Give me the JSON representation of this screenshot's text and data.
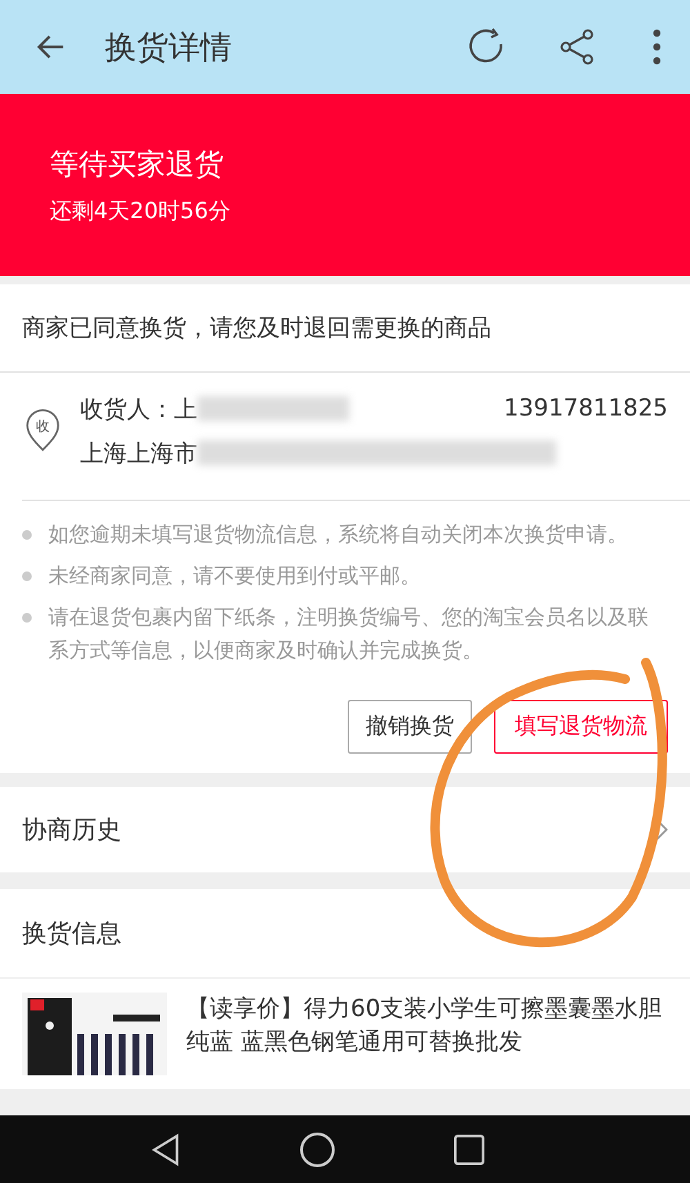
{
  "header": {
    "title": "换货详情"
  },
  "banner": {
    "status": "等待买家退货",
    "countdown": "还剩4天20时56分"
  },
  "notice": "商家已同意换货，请您及时退回需更换的商品",
  "address": {
    "badge": "收",
    "recipient": "收货人：上",
    "phone": "13917811825",
    "line": "上海上海市"
  },
  "tips": [
    "如您逾期未填写退货物流信息，系统将自动关闭本次换货申请。",
    "未经商家同意，请不要使用到付或平邮。",
    "请在退货包裹内留下纸条，注明换货编号、您的淘宝会员名以及联系方式等信息，以便商家及时确认并完成换货。"
  ],
  "buttons": [
    {
      "label": "撤销换货",
      "kind": "plain"
    },
    {
      "label": "填写退货物流",
      "kind": "primary"
    }
  ],
  "history": {
    "label": "协商历史"
  },
  "exchange": {
    "title": "换货信息",
    "product": {
      "kind": "picture",
      "name": "【读享价】得力60支装小学生可擦墨囊墨水胆纯蓝 蓝黑色钢笔通用可替换批发"
    }
  },
  "annotation": {
    "kind": "circle"
  }
}
